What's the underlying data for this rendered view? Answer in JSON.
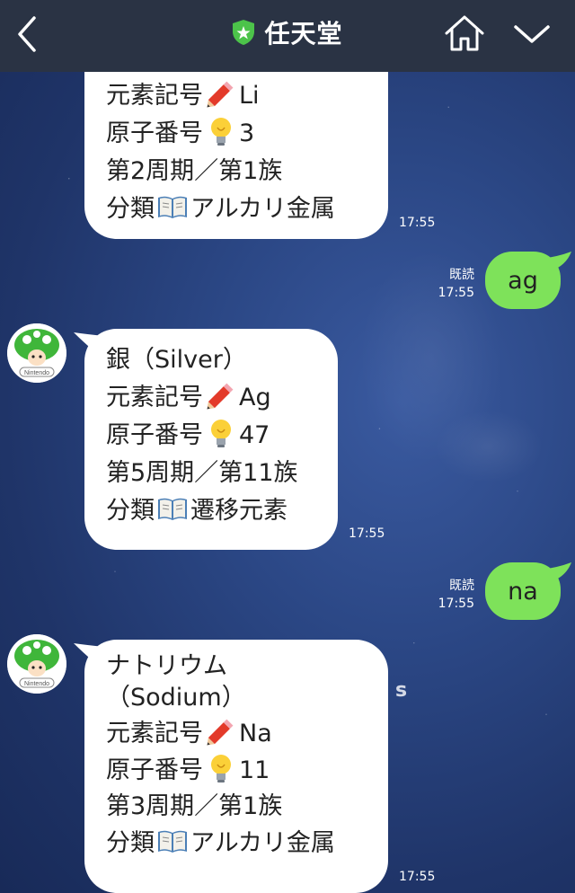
{
  "header": {
    "title": "任天堂",
    "back_icon": "chevron-left-icon",
    "home_icon": "home-icon",
    "menu_icon": "chevron-down-icon",
    "badge_icon": "green-shield-star-icon"
  },
  "messages": [
    {
      "side": "incoming",
      "lines": [
        {
          "label": "元素記号",
          "icon": "pencil-icon",
          "value": "Li"
        },
        {
          "label": "原子番号",
          "icon": "lightbulb-icon",
          "value": "3"
        },
        {
          "text": "第2周期／第1族"
        },
        {
          "label": "分類",
          "icon": "book-icon",
          "value": "アルカリ金属"
        }
      ],
      "time": "17:55"
    },
    {
      "side": "outgoing",
      "text": "ag",
      "read": "既読",
      "time": "17:55"
    },
    {
      "side": "incoming",
      "lines": [
        {
          "text": "銀（Silver）"
        },
        {
          "label": "元素記号",
          "icon": "pencil-icon",
          "value": "Ag"
        },
        {
          "label": "原子番号",
          "icon": "lightbulb-icon",
          "value": "47"
        },
        {
          "text": "第5周期／第11族"
        },
        {
          "label": "分類",
          "icon": "book-icon",
          "value": "遷移元素"
        }
      ],
      "time": "17:55"
    },
    {
      "side": "outgoing",
      "text": "na",
      "read": "既読",
      "time": "17:55"
    },
    {
      "side": "incoming",
      "lines": [
        {
          "text": "ナトリウム"
        },
        {
          "text": "（Sodium）"
        },
        {
          "label": "元素記号",
          "icon": "pencil-icon",
          "value": "Na"
        },
        {
          "label": "原子番号",
          "icon": "lightbulb-icon",
          "value": "11"
        },
        {
          "text": "第3周期／第1族"
        },
        {
          "label": "分類",
          "icon": "book-icon",
          "value": "アルカリ金属"
        }
      ],
      "time": "17:55"
    }
  ],
  "avatar": {
    "label": "Nintendo",
    "icon": "toad-avatar-icon"
  },
  "background_text": "s",
  "colors": {
    "header": "#2a3344",
    "outgoing_bubble": "#7ee25a",
    "incoming_bubble": "#ffffff",
    "accent_green": "#4cc34a"
  }
}
